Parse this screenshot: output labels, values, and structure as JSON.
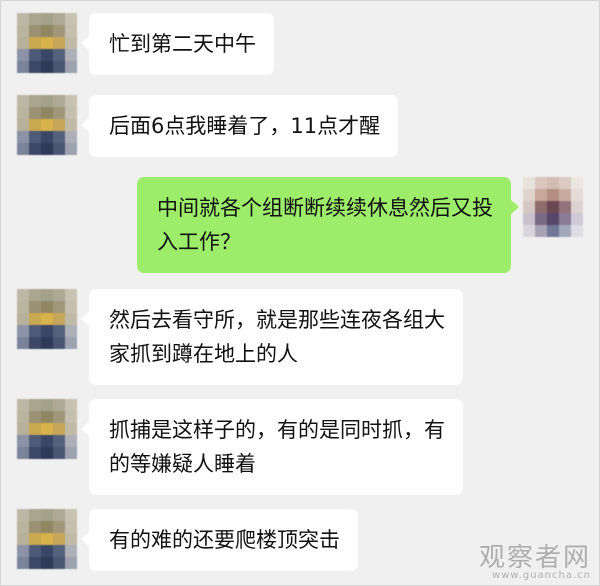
{
  "chat": {
    "messages": [
      {
        "side": "left",
        "text": "忙到第二天中午"
      },
      {
        "side": "left",
        "text": "后面6点我睡着了，11点才醒"
      },
      {
        "side": "right",
        "text": "中间就各个组断断续续休息然后又投\n入工作？"
      },
      {
        "side": "left",
        "text": "然后去看守所，就是那些连夜各组大\n家抓到蹲在地上的人"
      },
      {
        "side": "left",
        "text": "抓捕是这样子的，有的是同时抓，有\n的等嫌疑人睡着"
      },
      {
        "side": "left",
        "text": "有的难的还要爬楼顶突击"
      }
    ]
  },
  "watermark": {
    "name": "观察者网",
    "url": "www.guancha.cn"
  },
  "colors": {
    "background": "#f0f0f0",
    "bubble_incoming": "#ffffff",
    "bubble_outgoing": "#9ded6b"
  }
}
